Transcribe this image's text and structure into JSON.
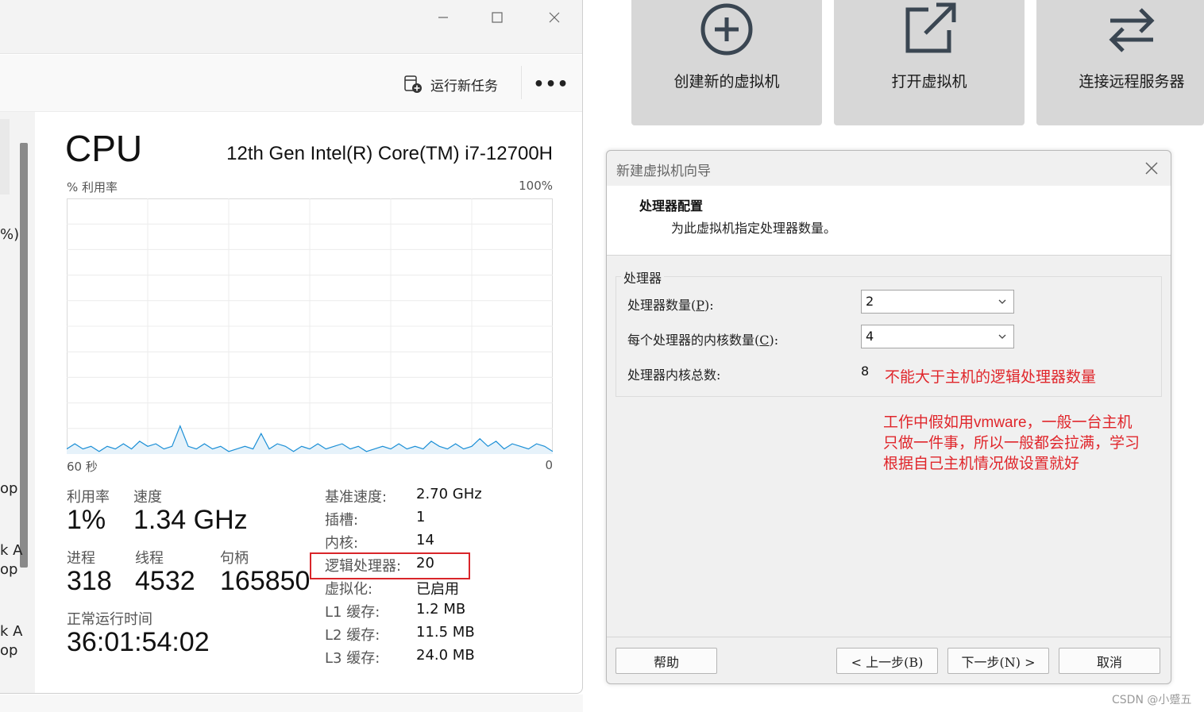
{
  "task_manager": {
    "toolbar": {
      "run_new_task": "运行新任务",
      "more": "•••"
    },
    "left_fragments": [
      "%)",
      "op",
      "k A",
      "op",
      "k A",
      "op"
    ],
    "cpu": {
      "title": "CPU",
      "model": "12th Gen Intel(R) Core(TM) i7-12700H",
      "util_label": "% 利用率",
      "util_max": "100%",
      "x_left": "60 秒",
      "x_right": "0"
    },
    "chart_data": {
      "type": "area",
      "x_range_seconds": [
        60,
        0
      ],
      "ylim": [
        0,
        100
      ],
      "grid": true,
      "values": [
        2,
        4,
        2,
        3,
        1,
        3,
        2,
        4,
        2,
        5,
        3,
        4,
        2,
        3,
        11,
        3,
        2,
        4,
        2,
        3,
        1,
        2,
        3,
        2,
        8,
        2,
        4,
        3,
        1,
        3,
        2,
        4,
        2,
        3,
        4,
        2,
        3,
        1,
        2,
        3,
        2,
        4,
        2,
        3,
        2,
        5,
        3,
        2,
        4,
        2,
        3,
        6,
        3,
        5,
        2,
        4,
        3,
        2,
        4,
        3,
        1
      ],
      "color": "#1b8fd6"
    },
    "stats": {
      "utilization": {
        "label": "利用率",
        "value": "1%"
      },
      "speed": {
        "label": "速度",
        "value": "1.34 GHz"
      },
      "processes": {
        "label": "进程",
        "value": "318"
      },
      "threads": {
        "label": "线程",
        "value": "4532"
      },
      "handles": {
        "label": "句柄",
        "value": "165850"
      },
      "uptime": {
        "label": "正常运行时间",
        "value": "36:01:54:02"
      }
    },
    "specs": [
      {
        "key": "基准速度:",
        "value": "2.70 GHz"
      },
      {
        "key": "插槽:",
        "value": "1"
      },
      {
        "key": "内核:",
        "value": "14"
      },
      {
        "key": "逻辑处理器:",
        "value": "20"
      },
      {
        "key": "虚拟化:",
        "value": "已启用"
      },
      {
        "key": "L1 缓存:",
        "value": "1.2 MB"
      },
      {
        "key": "L2 缓存:",
        "value": "11.5 MB"
      },
      {
        "key": "L3 缓存:",
        "value": "24.0 MB"
      }
    ]
  },
  "vmware_tiles": [
    {
      "label": "创建新的虚拟机",
      "icon": "plus-circle-icon"
    },
    {
      "label": "打开虚拟机",
      "icon": "open-external-icon"
    },
    {
      "label": "连接远程服务器",
      "icon": "swap-arrows-icon"
    }
  ],
  "wizard": {
    "title": "新建虚拟机向导",
    "heading": "处理器配置",
    "subheading": "为此虚拟机指定处理器数量。",
    "group_label": "处理器",
    "processor_count_label_pre": "处理器数量(",
    "processor_count_key": "P",
    "processor_count_label_post": "):",
    "processor_count_value": "2",
    "cores_label_pre": "每个处理器的内核数量(",
    "cores_key": "C",
    "cores_label_post": "):",
    "cores_value": "4",
    "total_label": "处理器内核总数:",
    "total_value": "8",
    "buttons": {
      "help": "帮助",
      "back": "< 上一步(B)",
      "next": "下一步(N) >",
      "cancel": "取消"
    }
  },
  "annotations": {
    "note_limit": "不能大于主机的逻辑处理器数量",
    "note_lines": [
      "工作中假如用vmware，一般一台主机",
      "只做一件事，所以一般都会拉满，学习",
      "根据自己主机情况做设置就好"
    ],
    "highlight_color": "#d9252a"
  },
  "watermark": "CSDN @小蹙五"
}
